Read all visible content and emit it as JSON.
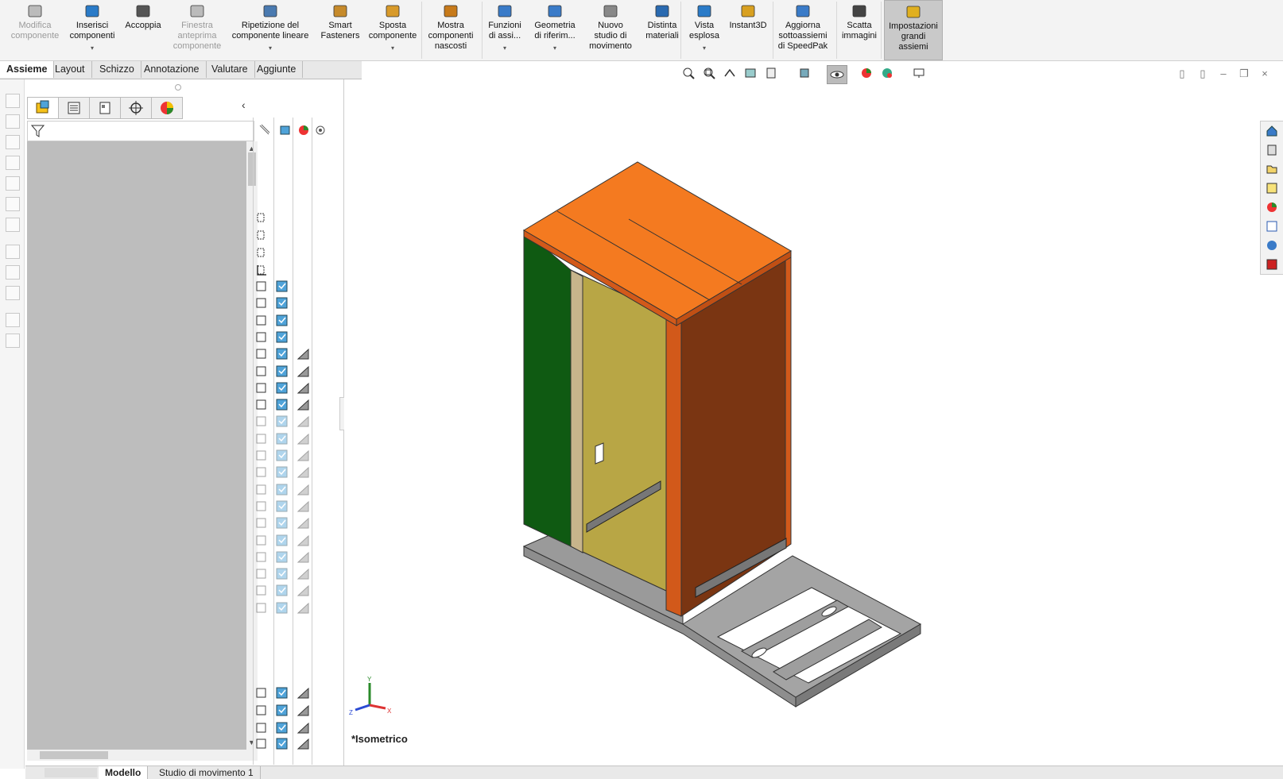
{
  "ribbon": {
    "buttons": [
      {
        "label": "Modifica\ncomponente",
        "state": "disabled"
      },
      {
        "label": "Inserisci\ncomponenti",
        "dropdown": true
      },
      {
        "label": "Accoppia"
      },
      {
        "label": "Finestra\nanteprima\ncomponente",
        "state": "disabled"
      },
      {
        "label": "Ripetizione del\ncomponente lineare",
        "dropdown": true
      },
      {
        "label": "Smart\nFasteners"
      },
      {
        "label": "Sposta\ncomponente",
        "dropdown": true
      },
      {
        "label": "Mostra\ncomponenti\nnascosti"
      },
      {
        "label": "Funzioni\ndi assi...",
        "dropdown": true
      },
      {
        "label": "Geometria\ndi riferim...",
        "dropdown": true
      },
      {
        "label": "Nuovo\nstudio di\nmovimento"
      },
      {
        "label": "Distinta\nmateriali"
      },
      {
        "label": "Vista\nesplosa",
        "dropdown": true
      },
      {
        "label": "Instant3D"
      },
      {
        "label": "Aggiorna\nsottoassiemi\ndi SpeedPak"
      },
      {
        "label": "Scatta\nimmagini"
      },
      {
        "label": "Impostazioni\ngrandi\nassiemi",
        "state": "active"
      }
    ]
  },
  "tabs": [
    "Assieme",
    "Layout",
    "Schizzo",
    "Annotazione",
    "Valutare",
    "Aggiunte"
  ],
  "bottom_tabs": [
    "Modello",
    "Studio di movimento 1"
  ],
  "viewport": {
    "view_label": "*Isometrico"
  },
  "triad": {
    "x": "X",
    "y": "Y",
    "z": "Z"
  },
  "colors": {
    "top_panel": "#f47a20",
    "left_panel": "#0f5a12",
    "back_panel": "#b8a645",
    "right_panel": "#7a3512",
    "floor": "#f4f06a",
    "base_frame": "#9a9a9a",
    "tree_bg": "#bdbdbd"
  }
}
